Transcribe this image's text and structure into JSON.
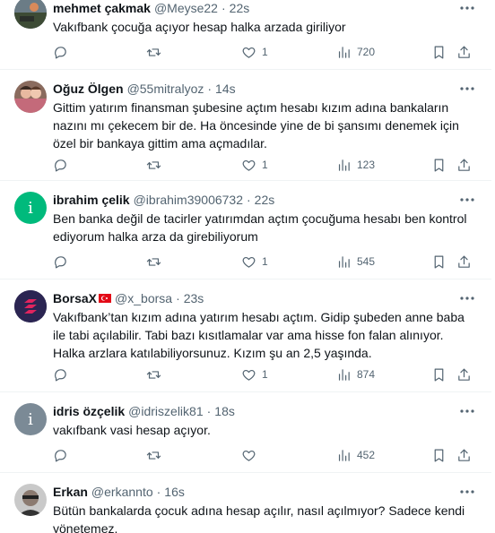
{
  "tweets": [
    {
      "name": "mehmet çakmak",
      "handle": "@Meyse22",
      "separator": "·",
      "time": "22s",
      "text": "Vakıfbank çocuğa açıyor hesap halka arzada giriliyor",
      "likes": "1",
      "views": "720",
      "replies": "",
      "retweets": ""
    },
    {
      "name": "Oğuz Ölgen",
      "handle": "@55mitralyoz",
      "separator": "·",
      "time": "14s",
      "text": "Gittim yatırım finansman şubesine açtım hesabı kızım adına bankaların nazını mı çekecem bir de.  Ha öncesinde yine de bi şansımı denemek için özel bir bankaya gittim ama açmadılar.",
      "likes": "1",
      "views": "123",
      "replies": "",
      "retweets": ""
    },
    {
      "name": "ibrahim çelik",
      "handle": "@ibrahim39006732",
      "separator": "·",
      "time": "22s",
      "avatar_letter": "i",
      "text": "Ben banka değil de tacirler yatırımdan açtım çocuğuma hesabı ben kontrol ediyorum halka arza da girebiliyorum",
      "likes": "1",
      "views": "545",
      "replies": "",
      "retweets": ""
    },
    {
      "name": "BorsaX",
      "handle": "@x_borsa",
      "separator": "·",
      "time": "23s",
      "text": "Vakıfbank’tan kızım adına yatırım hesabı açtım. Gidip şubeden anne baba ile tabi açılabilir. Tabi bazı kısıtlamalar var ama hisse fon falan alınıyor. Halka arzlara katılabiliyorsunuz. Kızım şu an 2,5 yaşında.",
      "likes": "1",
      "views": "874",
      "replies": "",
      "retweets": ""
    },
    {
      "name": "idris özçelik",
      "handle": "@idriszelik81",
      "separator": "·",
      "time": "18s",
      "avatar_letter": "i",
      "text": "vakıfbank vasi hesap açıyor.",
      "likes": "",
      "views": "452",
      "replies": "",
      "retweets": ""
    },
    {
      "name": "Erkan",
      "handle": "@erkannto",
      "separator": "·",
      "time": "16s",
      "text": "Bütün bankalarda çocuk adına hesap açılır, nasıl açılmıyor? Sadece kendi yönetemez."
    }
  ],
  "colors": {
    "text": "#0f1419",
    "secondary": "#536471",
    "divider": "#eff3f4",
    "green_avatar": "#00ba7c",
    "gray_avatar": "#7b8a96",
    "flag_red": "#e30a17"
  },
  "icons": [
    "more-icon",
    "reply-icon",
    "retweet-icon",
    "like-icon",
    "views-icon",
    "bookmark-icon",
    "share-icon"
  ]
}
